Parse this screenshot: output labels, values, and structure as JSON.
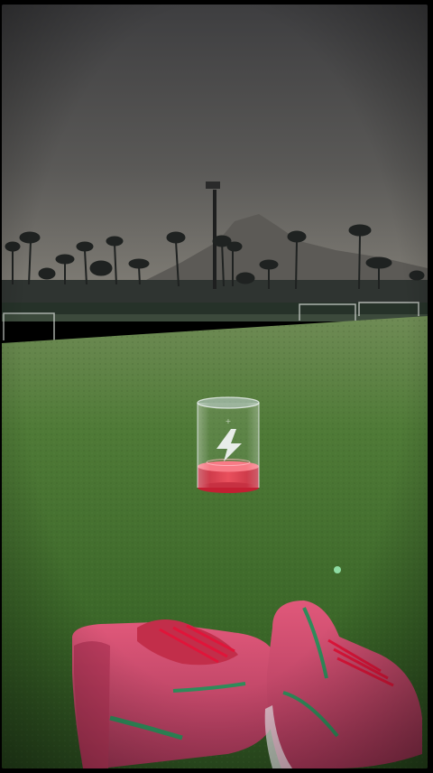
{
  "screen": {
    "type": "charging-animation-wallpaper",
    "background_scene": "football-pitch-at-dusk-with-palm-trees-and-mountain",
    "colors": {
      "sky_top": "#3f3f40",
      "sky_bottom": "#7a7872",
      "grass": "#3d6a2c",
      "grass_far": "#6e8b52",
      "battery_fill": "#e23a4a",
      "boots": "#d34a6a"
    }
  },
  "battery": {
    "level": 0.25,
    "icon": "lightning-bolt-icon"
  }
}
